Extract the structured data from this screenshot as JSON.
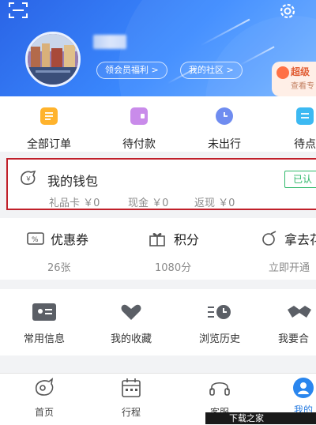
{
  "header": {
    "username_blurred": true,
    "pills": [
      "领会员福利 >",
      "我的社区 >"
    ],
    "promo_title": "超级",
    "promo_sub": "查看专"
  },
  "orders": [
    {
      "label": "全部订单",
      "icon": "order-list-icon",
      "color": "#ffb32c"
    },
    {
      "label": "待付款",
      "icon": "wallet-card-icon",
      "color": "#c98bea"
    },
    {
      "label": "未出行",
      "icon": "clock-icon",
      "color": "#6f8cf0"
    },
    {
      "label": "待点",
      "icon": "comment-icon",
      "color": "#3cb9f2"
    }
  ],
  "wallet": {
    "title": "我的钱包",
    "verified": "已认",
    "items": [
      "礼品卡 ￥0",
      "现金 ￥0",
      "返现 ￥0"
    ]
  },
  "benefits": [
    {
      "label": "优惠券",
      "value": "26张"
    },
    {
      "label": "积分",
      "value": "1080分"
    },
    {
      "label": "拿去花",
      "value": "立即开通"
    }
  ],
  "tools": [
    "常用信息",
    "我的收藏",
    "浏览历史",
    "我要合"
  ],
  "tabbar": [
    "首页",
    "行程",
    "客服",
    "我的"
  ],
  "watermark": "下载之家"
}
